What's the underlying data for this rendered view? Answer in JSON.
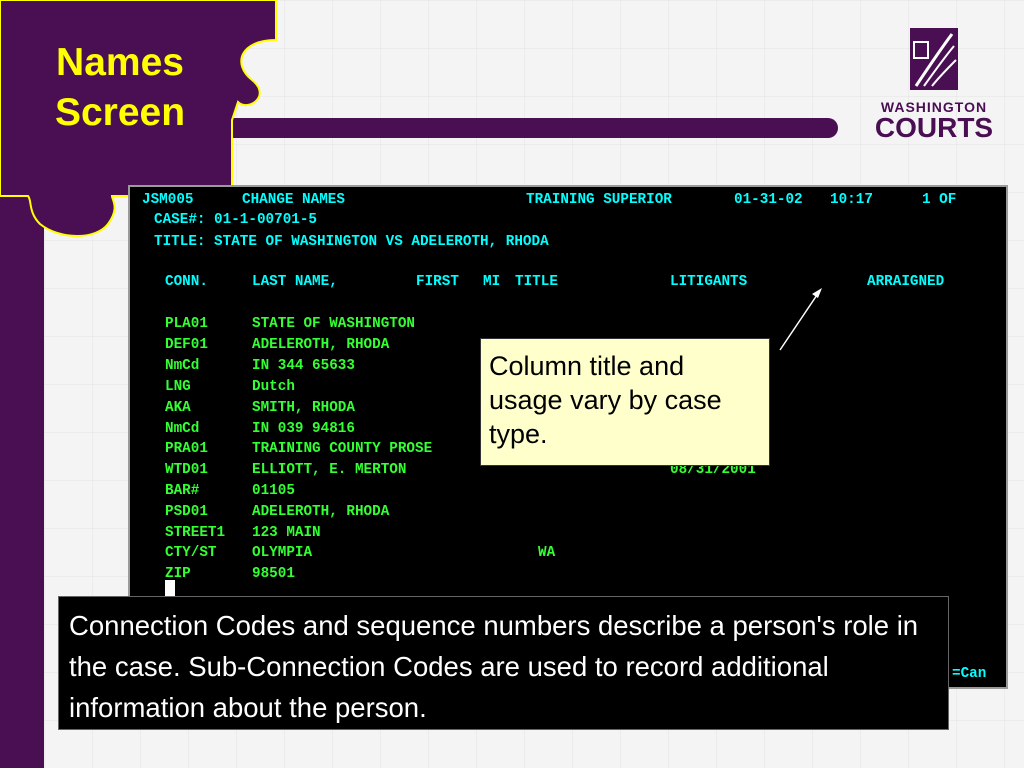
{
  "slide": {
    "title_line1": "Names",
    "title_line2": "Screen"
  },
  "logo": {
    "top_text": "WASHINGTON",
    "bottom_text": "COURTS"
  },
  "colors": {
    "brand_purple": "#4a0e52",
    "title_yellow": "#ffff00",
    "terminal_cyan": "#00ffff",
    "terminal_green": "#33ff33",
    "callout_fill": "#ffffcc"
  },
  "terminal": {
    "header": {
      "screen_id": "JSM005",
      "screen_name": "CHANGE NAMES",
      "court": "TRAINING SUPERIOR",
      "date": "01-31-02",
      "time": "10:17",
      "page": "1 OF"
    },
    "case_line": "CASE#: 01-1-00701-5",
    "title_line": "TITLE: STATE OF WASHINGTON VS ADELEROTH, RHODA",
    "columns": {
      "conn": "CONN.",
      "last_name": "LAST NAME,",
      "first": "FIRST",
      "mi": "MI",
      "title": "TITLE",
      "litigants": "LITIGANTS",
      "arraigned": "ARRAIGNED"
    },
    "rows": [
      {
        "code": "PLA01",
        "value": "STATE OF WASHINGTON"
      },
      {
        "code": "DEF01",
        "value": "ADELEROTH, RHODA"
      },
      {
        "code": "NmCd",
        "value": "IN 344 65633"
      },
      {
        "code": "LNG",
        "value": "Dutch"
      },
      {
        "code": "AKA",
        "value": "SMITH, RHODA"
      },
      {
        "code": "NmCd",
        "value": "IN 039 94816"
      },
      {
        "code": "PRA01",
        "value": "TRAINING COUNTY PROSE"
      },
      {
        "code": "WTD01",
        "value": "ELLIOTT, E. MERTON",
        "extra": "08/31/2001"
      },
      {
        "code": "BAR#",
        "value": "01105"
      },
      {
        "code": "PSD01",
        "value": "ADELEROTH, RHODA"
      },
      {
        "code": "STREET1",
        "value": "123 MAIN"
      },
      {
        "code": "CTY/ST",
        "value": "OLYMPIA",
        "extra": "WA"
      },
      {
        "code": "ZIP",
        "value": "98501"
      }
    ],
    "footer_partial": "=Can"
  },
  "callout": {
    "text": "Column title and usage vary by case type."
  },
  "note": {
    "text": "Connection Codes and sequence numbers describe a person's role in the case.  Sub-Connection Codes are used to record additional information about the person."
  }
}
